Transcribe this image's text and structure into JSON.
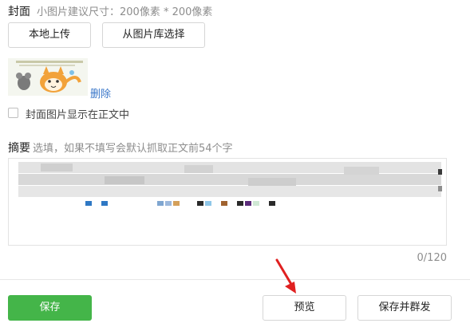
{
  "cover": {
    "label": "封面",
    "hint": "小图片建议尺寸：200像素 * 200像素",
    "upload_local": "本地上传",
    "select_from_library": "从图片库选择",
    "thumbnail_icon": "cartoon-cat-thumbnail",
    "delete_link": "删除",
    "show_in_body_checkbox": "封面图片显示在正文中",
    "show_in_body_checked": false
  },
  "summary": {
    "label": "摘要",
    "hint": "选填，如果不填写会默认抓取正文前54个字",
    "value": "",
    "counter": "0/120"
  },
  "footer": {
    "save": "保存",
    "preview": "预览",
    "save_and_send": "保存并群发"
  },
  "colors": {
    "primary_green": "#44b549",
    "link_blue": "#3a77c9",
    "annotation_arrow": "#e02020"
  }
}
